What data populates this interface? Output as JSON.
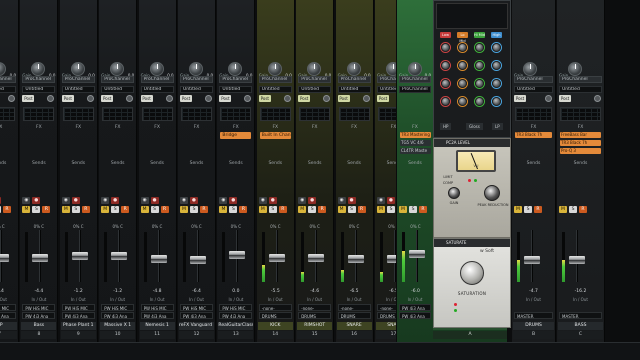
{
  "colors": {
    "drum_tint": "#3a3d1d",
    "master_tint": "#2e6f3a",
    "mute": "#d9b43a",
    "solo": "#d8d8d8",
    "fx_slot": "#e48a3a",
    "meter": "#4ecb3c"
  },
  "strips": [
    {
      "name": "HP",
      "num": "7",
      "proc": "ProChannel",
      "untitled": "Untitled",
      "gain": "0.0",
      "in": "PW HiS MIC",
      "out": "PW 4i3 Ana",
      "vol": "-4.4",
      "pan": "0% C",
      "fader": 0.55,
      "meter": 0.0,
      "drum": false
    },
    {
      "name": "Bass",
      "num": "8",
      "proc": "ProChannel",
      "untitled": "Untitled",
      "gain": "0.0",
      "in": "PW HiS MIC",
      "out": "PW 4i3 Ana",
      "vol": "-4.4",
      "pan": "0% C",
      "fader": 0.55,
      "meter": 0.0,
      "drum": false
    },
    {
      "name": "Phase Plant 1",
      "num": "9",
      "proc": "ProChannel",
      "untitled": "Untitled",
      "gain": "0.0",
      "in": "PW HiS MIC",
      "out": "PW 4i3 Ana",
      "vol": "-1.2",
      "pan": "0% C",
      "fader": 0.5,
      "meter": 0.0,
      "drum": false
    },
    {
      "name": "Massive X 1",
      "num": "10",
      "proc": "ProChannel",
      "untitled": "Untitled",
      "gain": "0.0",
      "in": "PW HiS MIC",
      "out": "PW 4i3 Ana",
      "vol": "-1.2",
      "pan": "0% C",
      "fader": 0.5,
      "meter": 0.0,
      "drum": false
    },
    {
      "name": "Nemesis 1",
      "num": "11",
      "proc": "ProChannel",
      "untitled": "Untitled",
      "gain": "0.0",
      "in": "PW HiS MIC",
      "out": "PW 4i3 Ana",
      "vol": "-4.8",
      "pan": "0% C",
      "fader": 0.56,
      "meter": 0.0,
      "drum": false
    },
    {
      "name": "reFX Vanguard 1",
      "num": "12",
      "proc": "ProChannel",
      "untitled": "Untitled",
      "gain": "0.0",
      "in": "PW HiS MIC",
      "out": "PW 4i3 Ana",
      "vol": "-6.4",
      "pan": "0% C",
      "fader": 0.58,
      "meter": 0.0,
      "drum": false
    },
    {
      "name": "RealGuitarClassic",
      "num": "13",
      "proc": "ProChannel",
      "untitled": "Untitled",
      "gain": "0.0",
      "in": "PW HiS MIC",
      "out": "PW 4i3 Ana",
      "vol": "0.0",
      "pan": "0% C",
      "fader": 0.47,
      "meter": 0.0,
      "drum": false,
      "fx": "Bridge"
    },
    {
      "name": "KICK",
      "num": "14",
      "proc": "ProChannel",
      "untitled": "Untitled",
      "gain": "0.0",
      "in": "-none-",
      "out": "DRUMS",
      "vol": "-5.5",
      "pan": "0% C",
      "fader": 0.55,
      "meter": 0.35,
      "drum": true,
      "fx": "Built In Channel"
    },
    {
      "name": "RIMSHOT",
      "num": "15",
      "proc": "ProChannel",
      "untitled": "Untitled",
      "gain": "0.0",
      "in": "-none-",
      "out": "DRUMS",
      "vol": "-4.6",
      "pan": "0% C",
      "fader": 0.55,
      "meter": 0.2,
      "drum": true
    },
    {
      "name": "SNARE",
      "num": "16",
      "proc": "ProChannel",
      "untitled": "Untitled",
      "gain": "0.0",
      "in": "-none-",
      "out": "DRUMS",
      "vol": "-6.5",
      "pan": "0% C",
      "fader": 0.56,
      "meter": 0.25,
      "drum": true
    },
    {
      "name": "SNAR",
      "num": "17",
      "proc": "ProChannel",
      "untitled": "Untitled",
      "gain": "0.0",
      "in": "-none-",
      "out": "DRUMS",
      "vol": "-6.5",
      "pan": "0% C",
      "fader": 0.56,
      "meter": 0.2,
      "drum": true
    }
  ],
  "master": {
    "name": "MASTER",
    "num": "A",
    "gain": "0.0",
    "in": "PW 4i3 Ana",
    "out": "PW 4i3 Ana",
    "vol": "-6.0",
    "pan": "0% C",
    "proc": "ProChannel",
    "fx1": "TR3 Mastering",
    "fx2": "TG5 VC 4/6",
    "fx3": "CL4TR Maste"
  },
  "plugin": {
    "eq_bands": [
      "Low",
      "Lo Mid",
      "Hi Mid",
      "High"
    ],
    "bottom_labels": [
      "HP",
      "Gloss",
      "LP"
    ],
    "comp_title": "PC2A LEVEL",
    "comp_vu": "VU",
    "comp_labels": [
      "GAIN",
      "PEAK REDUCTION",
      "LIMIT",
      "COMP"
    ],
    "sat_title": "SATURATE",
    "sat_brand": "w Soft",
    "sat_label": "SATURATION"
  },
  "right_strips": [
    {
      "name": "DRUMS",
      "num": "B",
      "fx": [
        "TR3 Black 7h"
      ],
      "vol": "-4.7",
      "out": "MASTER"
    },
    {
      "name": "BASS",
      "num": "C",
      "fx": [
        "FreeBass Bar",
        "TR3 Black 7h",
        "Pro-Q 3"
      ],
      "vol": "-16.2",
      "out": "MASTER"
    }
  ],
  "labels": {
    "fx": "FX",
    "sends": "Sends",
    "in_out": "In / Out",
    "post": "Post",
    "gain": "Gain"
  }
}
